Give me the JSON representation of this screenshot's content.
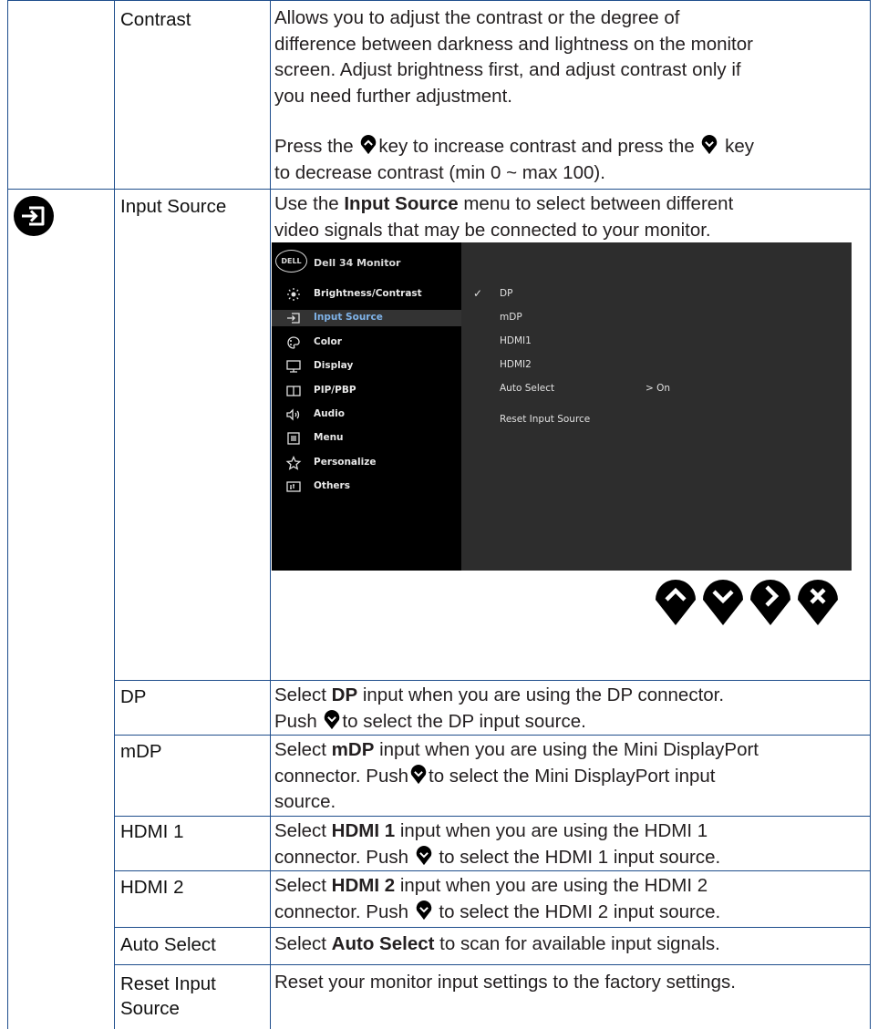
{
  "rows": {
    "contrast": {
      "label": "Contrast",
      "p1": "Allows you to adjust the contrast or the degree of",
      "p2": "difference between darkness and lightness on the monitor",
      "p3": "screen. Adjust brightness first, and adjust contrast only if",
      "p4": "you need further adjustment.",
      "p5a": "Press the",
      "p5b": "key to increase contrast and press the",
      "p5c": "key",
      "p6": "to decrease contrast (min 0 ~ max 100)."
    },
    "input_source": {
      "label": "Input Source",
      "l1a": "Use the ",
      "l1b": "Input Source",
      "l1c": " menu to select between different",
      "l2": "video signals that may be connected to your monitor.",
      "icon": "input-source-icon"
    },
    "dp": {
      "label": "DP",
      "l1a": "Select ",
      "l1b": "DP",
      "l1c": " input when you are using the DP connector.",
      "l2a": "Push ",
      "l2b": "to select the DP input source."
    },
    "mdp": {
      "label": "mDP",
      "l1a": "Select ",
      "l1b": "mDP",
      "l1c": " input when you are using the Mini DisplayPort",
      "l2a": "connector. Push",
      "l2b": "to select the Mini DisplayPort input",
      "l3": "source."
    },
    "hdmi1": {
      "label": "HDMI 1",
      "l1a": "Select ",
      "l1b": "HDMI 1",
      "l1c": " input when you are using the HDMI 1",
      "l2a": "connector. Push ",
      "l2b": " to select the HDMI 1 input source."
    },
    "hdmi2": {
      "label": "HDMI 2",
      "l1a": "Select ",
      "l1b": "HDMI 2",
      "l1c": " input when you are using the HDMI 2",
      "l2a": "connector. Push ",
      "l2b": " to select the HDMI 2 input source."
    },
    "auto_select": {
      "label": "Auto Select",
      "l1a": "Select ",
      "l1b": "Auto Select",
      "l1c": " to scan for available input signals."
    },
    "reset": {
      "label1": "Reset Input",
      "label2": "Source",
      "l1": "Reset your monitor input settings to the factory settings."
    }
  },
  "osd": {
    "logo": "DELL",
    "title": "Dell 34 Monitor",
    "menu": [
      {
        "label": "Brightness/Contrast",
        "icon": "brightness-icon"
      },
      {
        "label": "Input Source",
        "icon": "input-source-icon",
        "active": true
      },
      {
        "label": "Color",
        "icon": "color-palette-icon"
      },
      {
        "label": "Display",
        "icon": "display-icon"
      },
      {
        "label": "PIP/PBP",
        "icon": "pip-pbp-icon"
      },
      {
        "label": "Audio",
        "icon": "speaker-icon"
      },
      {
        "label": "Menu",
        "icon": "menu-icon"
      },
      {
        "label": "Personalize",
        "icon": "star-icon"
      },
      {
        "label": "Others",
        "icon": "others-icon"
      }
    ],
    "options": [
      {
        "label": "DP",
        "checked": true
      },
      {
        "label": "mDP"
      },
      {
        "label": "HDMI1"
      },
      {
        "label": "HDMI2"
      },
      {
        "label": "Auto Select",
        "value": "> On"
      },
      {
        "label": "Reset Input Source"
      }
    ],
    "check_mark": "✓",
    "colors": {
      "menu_bg": "#000000",
      "panel_bg": "#2d2d2d",
      "active_text": "#7fb3e8"
    }
  },
  "nav_buttons": [
    "up-button-icon",
    "down-button-icon",
    "right-button-icon",
    "close-button-icon"
  ]
}
